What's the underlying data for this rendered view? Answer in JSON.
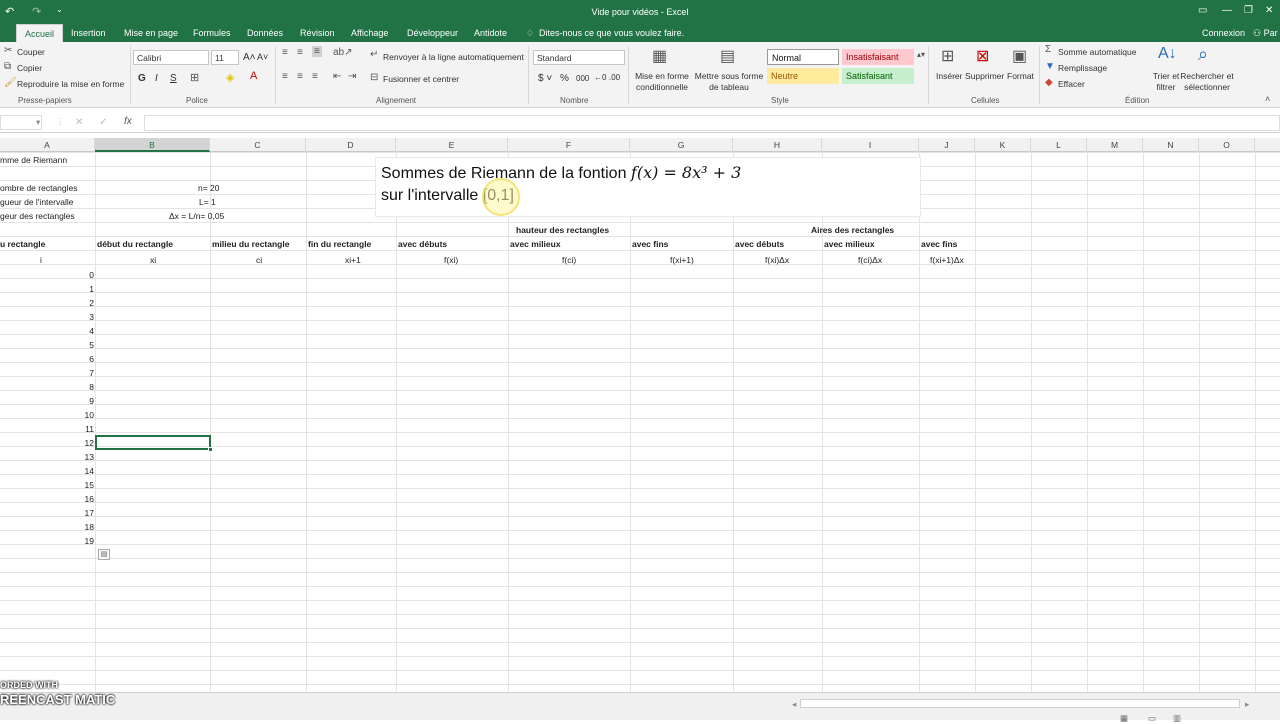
{
  "window": {
    "title": "Vide pour vidéos - Excel",
    "connexion": "Connexion",
    "share": "Par"
  },
  "tabs": [
    "Accueil",
    "Insertion",
    "Mise en page",
    "Formules",
    "Données",
    "Révision",
    "Affichage",
    "Développeur",
    "Antidote"
  ],
  "tell_me": "Dites-nous ce que vous voulez faire.",
  "ribbon": {
    "clipboard": {
      "cut": "Couper",
      "copy": "Copier",
      "painter": "Reproduire la mise en forme",
      "label": "Presse-papiers"
    },
    "font": {
      "name": "Calibri",
      "size": "11",
      "bold": "G",
      "italic": "I",
      "underline": "S",
      "label": "Police"
    },
    "alignment": {
      "wrap": "Renvoyer à la ligne automatiquement",
      "merge": "Fusionner et centrer",
      "label": "Alignement"
    },
    "number": {
      "format": "Standard",
      "pct": "%",
      "thousands": "000",
      "label": "Nombre"
    },
    "style": {
      "cond": "Mise en forme conditionnelle",
      "table": "Mettre sous forme de tableau",
      "normal": "Normal",
      "bad": "Insatisfaisant",
      "neutral": "Neutre",
      "good": "Satisfaisant",
      "label": "Style"
    },
    "cells": {
      "insert": "Insérer",
      "delete": "Supprimer",
      "format": "Format",
      "label": "Cellules"
    },
    "editing": {
      "autosum": "Somme automatique",
      "fill": "Remplissage",
      "clear": "Effacer",
      "sort": "Trier et filtrer",
      "find": "Rechercher et sélectionner",
      "label": "Édition"
    }
  },
  "formula_bar": {
    "fx": "fx"
  },
  "columns": [
    "A",
    "B",
    "C",
    "D",
    "E",
    "F",
    "G",
    "H",
    "I",
    "J",
    "K",
    "L",
    "M",
    "N",
    "O"
  ],
  "cells": {
    "a1": "mme de Riemann",
    "a3": "ombre de rectangles",
    "b3": "n= 20",
    "a4": "gueur de l'intervalle",
    "b4": "L= 1",
    "a5": "geur des rectangles",
    "b5": "Δx = L/n= 0,05",
    "hdr_hauteur": "hauteur des rectangles",
    "hdr_aires": "Aires des rectangles",
    "r7": [
      "u rectangle",
      "début du rectangle",
      "milieu du rectangle",
      "fin du rectangle",
      "avec débuts",
      "avec milieux",
      "avec fins",
      "avec débuts",
      "avec milieux",
      "avec fins"
    ],
    "r8": [
      "i",
      "xi",
      "ci",
      "xi+1",
      "f(xi)",
      "f(ci)",
      "f(xi+1)",
      "f(xi)Δx",
      "f(ci)Δx",
      "f(xi+1)Δx"
    ]
  },
  "row_indices": [
    "0",
    "1",
    "2",
    "3",
    "4",
    "5",
    "6",
    "7",
    "8",
    "9",
    "10",
    "11",
    "12",
    "13",
    "14",
    "15",
    "16",
    "17",
    "18",
    "19"
  ],
  "textbox": {
    "line1_text": "Sommes de Riemann de la fontion",
    "line1_math": "f(x) = 8x³ + 3",
    "line2": "sur l'intervalle [0,1]"
  },
  "watermark": {
    "top": "ORDED WITH",
    "brand": "REENCAST MATIC"
  }
}
